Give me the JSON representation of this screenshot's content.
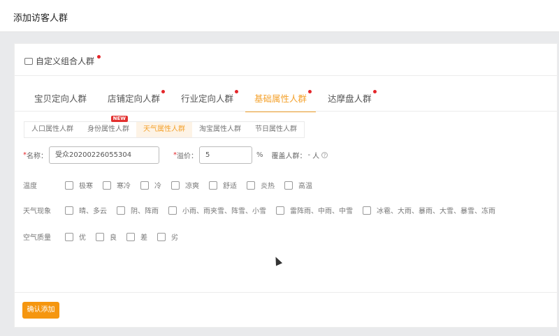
{
  "dialog": {
    "title": "添加访客人群"
  },
  "panel": {
    "header": "自定义组合人群"
  },
  "tabs": [
    {
      "label": "宝贝定向人群",
      "dot": false
    },
    {
      "label": "店铺定向人群",
      "dot": true
    },
    {
      "label": "行业定向人群",
      "dot": true
    },
    {
      "label": "基础属性人群",
      "dot": true,
      "active": true
    },
    {
      "label": "达摩盘人群",
      "dot": true
    }
  ],
  "subtabs": [
    {
      "label": "人口属性人群"
    },
    {
      "label": "身份属性人群",
      "badge": "NEW"
    },
    {
      "label": "天气属性人群",
      "active": true
    },
    {
      "label": "淘宝属性人群"
    },
    {
      "label": "节日属性人群"
    }
  ],
  "form": {
    "name_label": "名称：",
    "name_value": "受众20200226055304",
    "premium_label": "溢价：",
    "premium_value": "5",
    "premium_unit": "%",
    "coverage_label": "覆盖人群：",
    "coverage_value": "-",
    "coverage_unit": "人"
  },
  "rows": [
    {
      "label": "温度",
      "options": [
        "极寒",
        "寒冷",
        "冷",
        "凉爽",
        "舒适",
        "炎热",
        "高温"
      ]
    },
    {
      "label": "天气现象",
      "options": [
        "晴、多云",
        "阴、阵雨",
        "小雨、雨夹雪、阵雪、小雪",
        "雷阵雨、中雨、中雪",
        "冰雹、大雨、暴雨、大雪、暴雪、冻雨"
      ]
    },
    {
      "label": "空气质量",
      "options": [
        "优",
        "良",
        "差",
        "劣"
      ]
    }
  ],
  "confirm_label": "确认添加",
  "colors": {
    "accent": "#f4a22d",
    "button": "#f5960f",
    "dot": "#e4262a"
  }
}
